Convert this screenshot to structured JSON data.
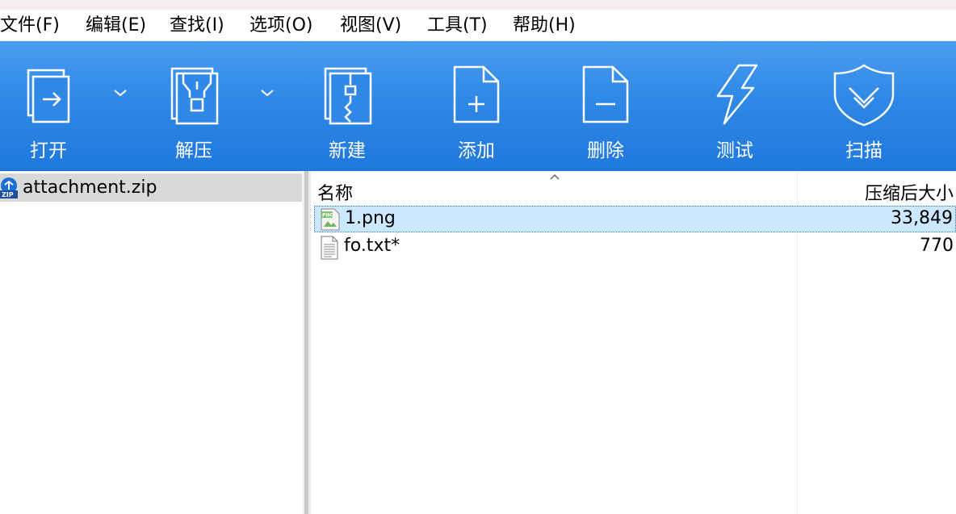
{
  "menu": {
    "items": [
      {
        "label": "文件(F)"
      },
      {
        "label": "编辑(E)"
      },
      {
        "label": "查找(I)"
      },
      {
        "label": "选项(O)"
      },
      {
        "label": "视图(V)"
      },
      {
        "label": "工具(T)"
      },
      {
        "label": "帮助(H)"
      }
    ]
  },
  "toolbar": {
    "open": "打开",
    "extract": "解压",
    "new": "新建",
    "add": "添加",
    "delete": "删除",
    "test": "测试",
    "scan": "扫描"
  },
  "tree": {
    "item": "attachment.zip"
  },
  "list": {
    "col_name": "名称",
    "col_size": "压缩后大小",
    "rows": [
      {
        "name": "1.png",
        "size": "33,849",
        "icon": "png-file-icon"
      },
      {
        "name": "fo.txt*",
        "size": "770",
        "icon": "text-file-icon"
      }
    ]
  },
  "colors": {
    "toolbar_top": "#4a9ef0",
    "toolbar_bottom": "#1f78dc",
    "selection": "#cce8ff"
  }
}
